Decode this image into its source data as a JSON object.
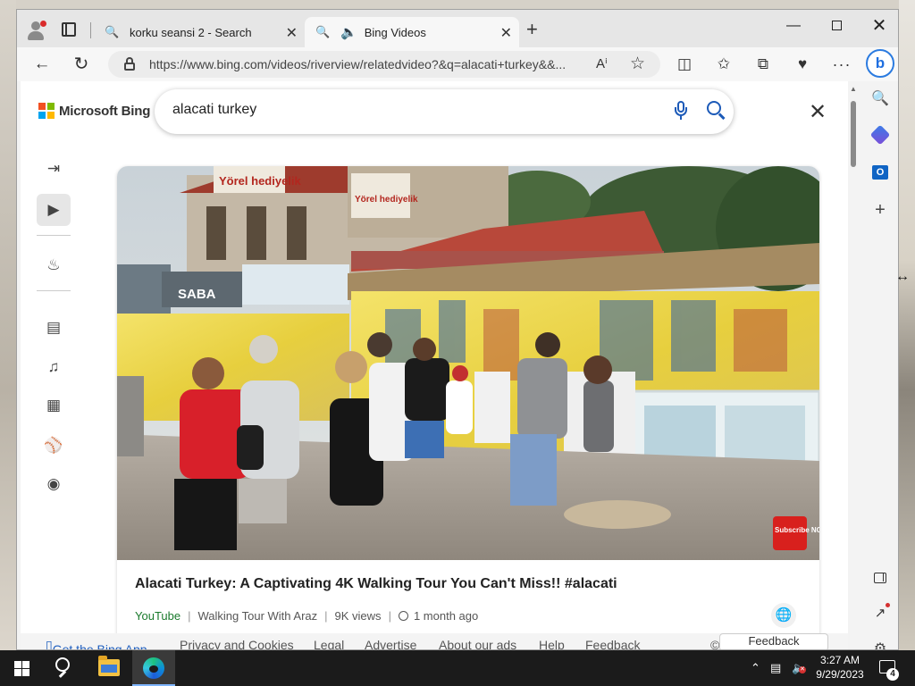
{
  "browser": {
    "tabs": [
      {
        "title": "korku seansi 2 - Search",
        "icon": "search-icon"
      },
      {
        "title": "Bing Videos",
        "icon": "search-icon",
        "audio_icon": "speaker-icon",
        "active": true
      }
    ],
    "new_tab_label": "+",
    "address": "https://www.bing.com/videos/riverview/relatedvideo?&q=alacati+turkey&&..."
  },
  "page": {
    "logo_text": "Microsoft Bing",
    "search_value": "alacati turkey",
    "video": {
      "title": "Alacati Turkey: A Captivating 4K Walking Tour You Can't Miss!! #alacati",
      "source": "YouTube",
      "channel": "Walking Tour With Araz",
      "views": "9K views",
      "age": "1 month ago",
      "thumbnail_signs": [
        "Yörel hediyelik",
        "Yörel hediyelik",
        "SABA"
      ],
      "thumbnail_badge": "Subscribe NOW"
    },
    "left_nav": [
      "exit-icon",
      "video-icon",
      "trending-icon",
      "movies-icon",
      "music-icon",
      "news-icon",
      "sports-icon",
      "gaming-icon"
    ],
    "footer": {
      "get_app": "Get the Bing App",
      "links": [
        "Privacy and Cookies",
        "Legal",
        "Advertise",
        "About our ads",
        "Help",
        "Feedback"
      ],
      "copyright": "©",
      "feedback_button": "Feedback"
    }
  },
  "taskbar": {
    "time": "3:27 AM",
    "date": "9/29/2023",
    "notification_count": "4"
  },
  "colors": {
    "accent": "#1c5ab8",
    "source_green": "#1a7a2c",
    "ms_red": "#f25022",
    "ms_green": "#7fba00",
    "ms_blue": "#00a4ef",
    "ms_yellow": "#ffb900"
  }
}
